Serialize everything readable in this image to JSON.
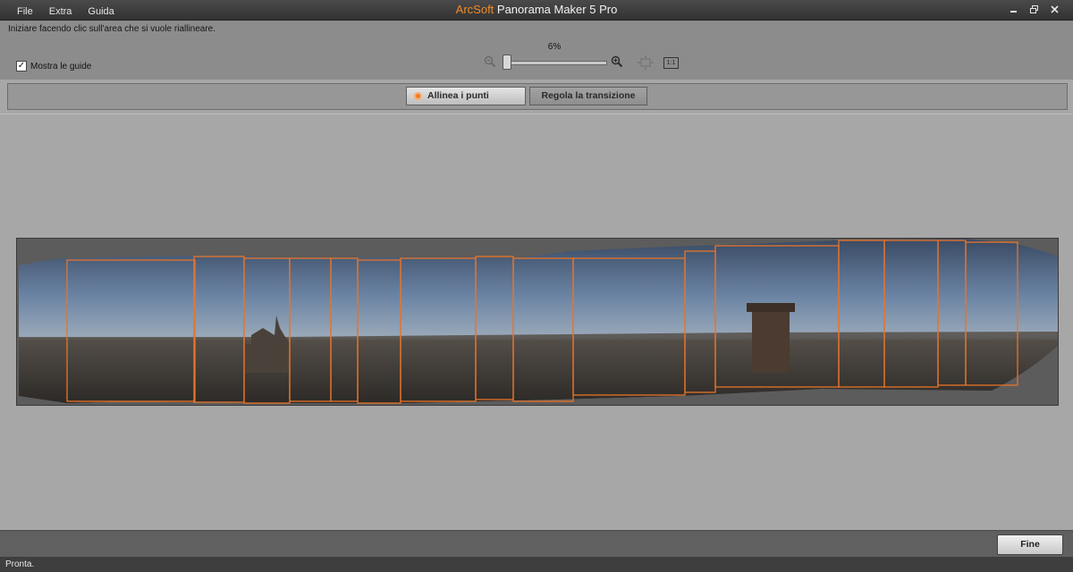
{
  "menu": {
    "items": [
      "File",
      "Extra",
      "Guida"
    ]
  },
  "app_title": {
    "brand": "ArcSoft",
    "name": " Panorama Maker 5 Pro"
  },
  "instruction": "Iniziare facendo clic sull'area che si vuole riallineare.",
  "guides": {
    "label": "Mostra le guide",
    "checked": true
  },
  "zoom": {
    "percent_label": "6%",
    "value_percent": 6,
    "actual_size_label": "1:1"
  },
  "mode_tabs": {
    "align": "Allinea i punti",
    "transition": "Regola la transizione",
    "active": "align"
  },
  "finish_button": "Fine",
  "status": "Pronta.",
  "colors": {
    "accent": "#f08a2a",
    "frame": "#e8742a"
  },
  "icons": [
    "minimize-icon",
    "restore-icon",
    "close-icon",
    "zoom-out-icon",
    "zoom-in-icon",
    "fit-view-icon",
    "checkmark-icon"
  ]
}
